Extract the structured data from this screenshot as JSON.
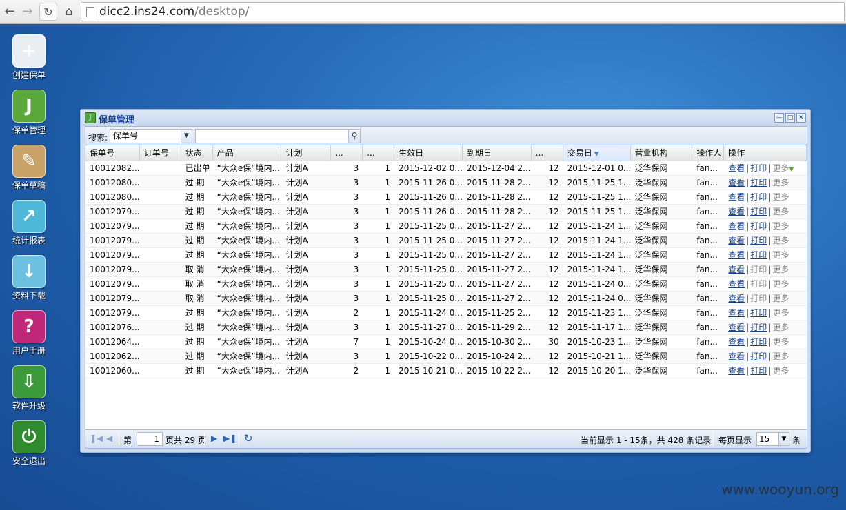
{
  "browser": {
    "address_host": "dicc2.ins24.com",
    "address_path": "/desktop/"
  },
  "desktop_icons": [
    {
      "label": "创建保单",
      "icon": "create-policy-icon",
      "color": "#e9eef2"
    },
    {
      "label": "保单管理",
      "icon": "umbrella-icon",
      "color": "#5aa83a"
    },
    {
      "label": "保单草稿",
      "icon": "clipboard-icon",
      "color": "#c9a36a"
    },
    {
      "label": "统计报表",
      "icon": "chart-icon",
      "color": "#4fb8d8"
    },
    {
      "label": "资料下载",
      "icon": "download-doc-icon",
      "color": "#6cc0e0"
    },
    {
      "label": "用户手册",
      "icon": "help-icon",
      "color": "#c2287a"
    },
    {
      "label": "软件升级",
      "icon": "upgrade-icon",
      "color": "#3b9a3a"
    },
    {
      "label": "安全退出",
      "icon": "power-icon",
      "color": "#2e8b2e"
    }
  ],
  "window": {
    "title": "保单管理"
  },
  "search": {
    "label": "搜索:",
    "field_value": "保单号",
    "input_value": ""
  },
  "grid": {
    "columns": [
      "保单号",
      "订单号",
      "状态",
      "产品",
      "计划",
      "...",
      "...",
      "生效日",
      "到期日",
      "...",
      "交易日",
      "营业机构",
      "操作人",
      "操作"
    ],
    "rows": [
      {
        "policy": "10012082...",
        "order": "",
        "status": "已出单",
        "product": "“大众e保”境内...",
        "plan": "计划A",
        "n1": "3",
        "n2": "1",
        "start": "2015-12-02 0...",
        "end": "2015-12-04 2...",
        "n3": "12",
        "trade": "2015-12-01 0...",
        "org": "泛华保网",
        "op": "fan...",
        "view": "查看",
        "print": "打印",
        "more": "更多",
        "print_enabled": true
      },
      {
        "policy": "10012080...",
        "order": "",
        "status": "过 期",
        "product": "“大众e保”境内...",
        "plan": "计划A",
        "n1": "3",
        "n2": "1",
        "start": "2015-11-26 0...",
        "end": "2015-11-28 2...",
        "n3": "12",
        "trade": "2015-11-25 1...",
        "org": "泛华保网",
        "op": "fan...",
        "view": "查看",
        "print": "打印",
        "more": "更多",
        "print_enabled": true
      },
      {
        "policy": "10012080...",
        "order": "",
        "status": "过 期",
        "product": "“大众e保”境内...",
        "plan": "计划A",
        "n1": "3",
        "n2": "1",
        "start": "2015-11-26 0...",
        "end": "2015-11-28 2...",
        "n3": "12",
        "trade": "2015-11-25 1...",
        "org": "泛华保网",
        "op": "fan...",
        "view": "查看",
        "print": "打印",
        "more": "更多",
        "print_enabled": true
      },
      {
        "policy": "10012079...",
        "order": "",
        "status": "过 期",
        "product": "“大众e保”境内...",
        "plan": "计划A",
        "n1": "3",
        "n2": "1",
        "start": "2015-11-26 0...",
        "end": "2015-11-28 2...",
        "n3": "12",
        "trade": "2015-11-25 1...",
        "org": "泛华保网",
        "op": "fan...",
        "view": "查看",
        "print": "打印",
        "more": "更多",
        "print_enabled": true
      },
      {
        "policy": "10012079...",
        "order": "",
        "status": "过 期",
        "product": "“大众e保”境内...",
        "plan": "计划A",
        "n1": "3",
        "n2": "1",
        "start": "2015-11-25 0...",
        "end": "2015-11-27 2...",
        "n3": "12",
        "trade": "2015-11-24 1...",
        "org": "泛华保网",
        "op": "fan...",
        "view": "查看",
        "print": "打印",
        "more": "更多",
        "print_enabled": true
      },
      {
        "policy": "10012079...",
        "order": "",
        "status": "过 期",
        "product": "“大众e保”境内...",
        "plan": "计划A",
        "n1": "3",
        "n2": "1",
        "start": "2015-11-25 0...",
        "end": "2015-11-27 2...",
        "n3": "12",
        "trade": "2015-11-24 1...",
        "org": "泛华保网",
        "op": "fan...",
        "view": "查看",
        "print": "打印",
        "more": "更多",
        "print_enabled": true
      },
      {
        "policy": "10012079...",
        "order": "",
        "status": "过 期",
        "product": "“大众e保”境内...",
        "plan": "计划A",
        "n1": "3",
        "n2": "1",
        "start": "2015-11-25 0...",
        "end": "2015-11-27 2...",
        "n3": "12",
        "trade": "2015-11-24 1...",
        "org": "泛华保网",
        "op": "fan...",
        "view": "查看",
        "print": "打印",
        "more": "更多",
        "print_enabled": true
      },
      {
        "policy": "10012079...",
        "order": "",
        "status": "取 消",
        "product": "“大众e保”境内...",
        "plan": "计划A",
        "n1": "3",
        "n2": "1",
        "start": "2015-11-25 0...",
        "end": "2015-11-27 2...",
        "n3": "12",
        "trade": "2015-11-24 1...",
        "org": "泛华保网",
        "op": "fan...",
        "view": "查看",
        "print": "打印",
        "more": "更多",
        "print_enabled": false
      },
      {
        "policy": "10012079...",
        "order": "",
        "status": "取 消",
        "product": "“大众e保”境内...",
        "plan": "计划A",
        "n1": "3",
        "n2": "1",
        "start": "2015-11-25 0...",
        "end": "2015-11-27 2...",
        "n3": "12",
        "trade": "2015-11-24 0...",
        "org": "泛华保网",
        "op": "fan...",
        "view": "查看",
        "print": "打印",
        "more": "更多",
        "print_enabled": false
      },
      {
        "policy": "10012079...",
        "order": "",
        "status": "取 消",
        "product": "“大众e保”境内...",
        "plan": "计划A",
        "n1": "3",
        "n2": "1",
        "start": "2015-11-25 0...",
        "end": "2015-11-27 2...",
        "n3": "12",
        "trade": "2015-11-24 0...",
        "org": "泛华保网",
        "op": "fan...",
        "view": "查看",
        "print": "打印",
        "more": "更多",
        "print_enabled": false
      },
      {
        "policy": "10012079...",
        "order": "",
        "status": "过 期",
        "product": "“大众e保”境内...",
        "plan": "计划A",
        "n1": "2",
        "n2": "1",
        "start": "2015-11-24 0...",
        "end": "2015-11-25 2...",
        "n3": "12",
        "trade": "2015-11-23 1...",
        "org": "泛华保网",
        "op": "fan...",
        "view": "查看",
        "print": "打印",
        "more": "更多",
        "print_enabled": true
      },
      {
        "policy": "10012076...",
        "order": "",
        "status": "过 期",
        "product": "“大众e保”境内...",
        "plan": "计划A",
        "n1": "3",
        "n2": "1",
        "start": "2015-11-27 0...",
        "end": "2015-11-29 2...",
        "n3": "12",
        "trade": "2015-11-17 1...",
        "org": "泛华保网",
        "op": "fan...",
        "view": "查看",
        "print": "打印",
        "more": "更多",
        "print_enabled": true
      },
      {
        "policy": "10012064...",
        "order": "",
        "status": "过 期",
        "product": "“大众e保”境内...",
        "plan": "计划A",
        "n1": "7",
        "n2": "1",
        "start": "2015-10-24 0...",
        "end": "2015-10-30 2...",
        "n3": "30",
        "trade": "2015-10-23 1...",
        "org": "泛华保网",
        "op": "fan...",
        "view": "查看",
        "print": "打印",
        "more": "更多",
        "print_enabled": true
      },
      {
        "policy": "10012062...",
        "order": "",
        "status": "过 期",
        "product": "“大众e保”境内...",
        "plan": "计划A",
        "n1": "3",
        "n2": "1",
        "start": "2015-10-22 0...",
        "end": "2015-10-24 2...",
        "n3": "12",
        "trade": "2015-10-21 1...",
        "org": "泛华保网",
        "op": "fan...",
        "view": "查看",
        "print": "打印",
        "more": "更多",
        "print_enabled": true
      },
      {
        "policy": "10012060...",
        "order": "",
        "status": "过 期",
        "product": "“大众e保”境内...",
        "plan": "计划A",
        "n1": "2",
        "n2": "1",
        "start": "2015-10-21 0...",
        "end": "2015-10-22 2...",
        "n3": "12",
        "trade": "2015-10-20 1...",
        "org": "泛华保网",
        "op": "fan...",
        "view": "查看",
        "print": "打印",
        "more": "更多",
        "print_enabled": true
      }
    ]
  },
  "paging": {
    "page_prefix": "第",
    "current_page": "1",
    "page_suffix": "页共 29 页",
    "display_info": "当前显示 1 - 15条，共 428 条记录",
    "page_size_label": "每页显示",
    "page_size": "15",
    "page_size_suffix": "条"
  },
  "watermark": "www.wooyun.org"
}
